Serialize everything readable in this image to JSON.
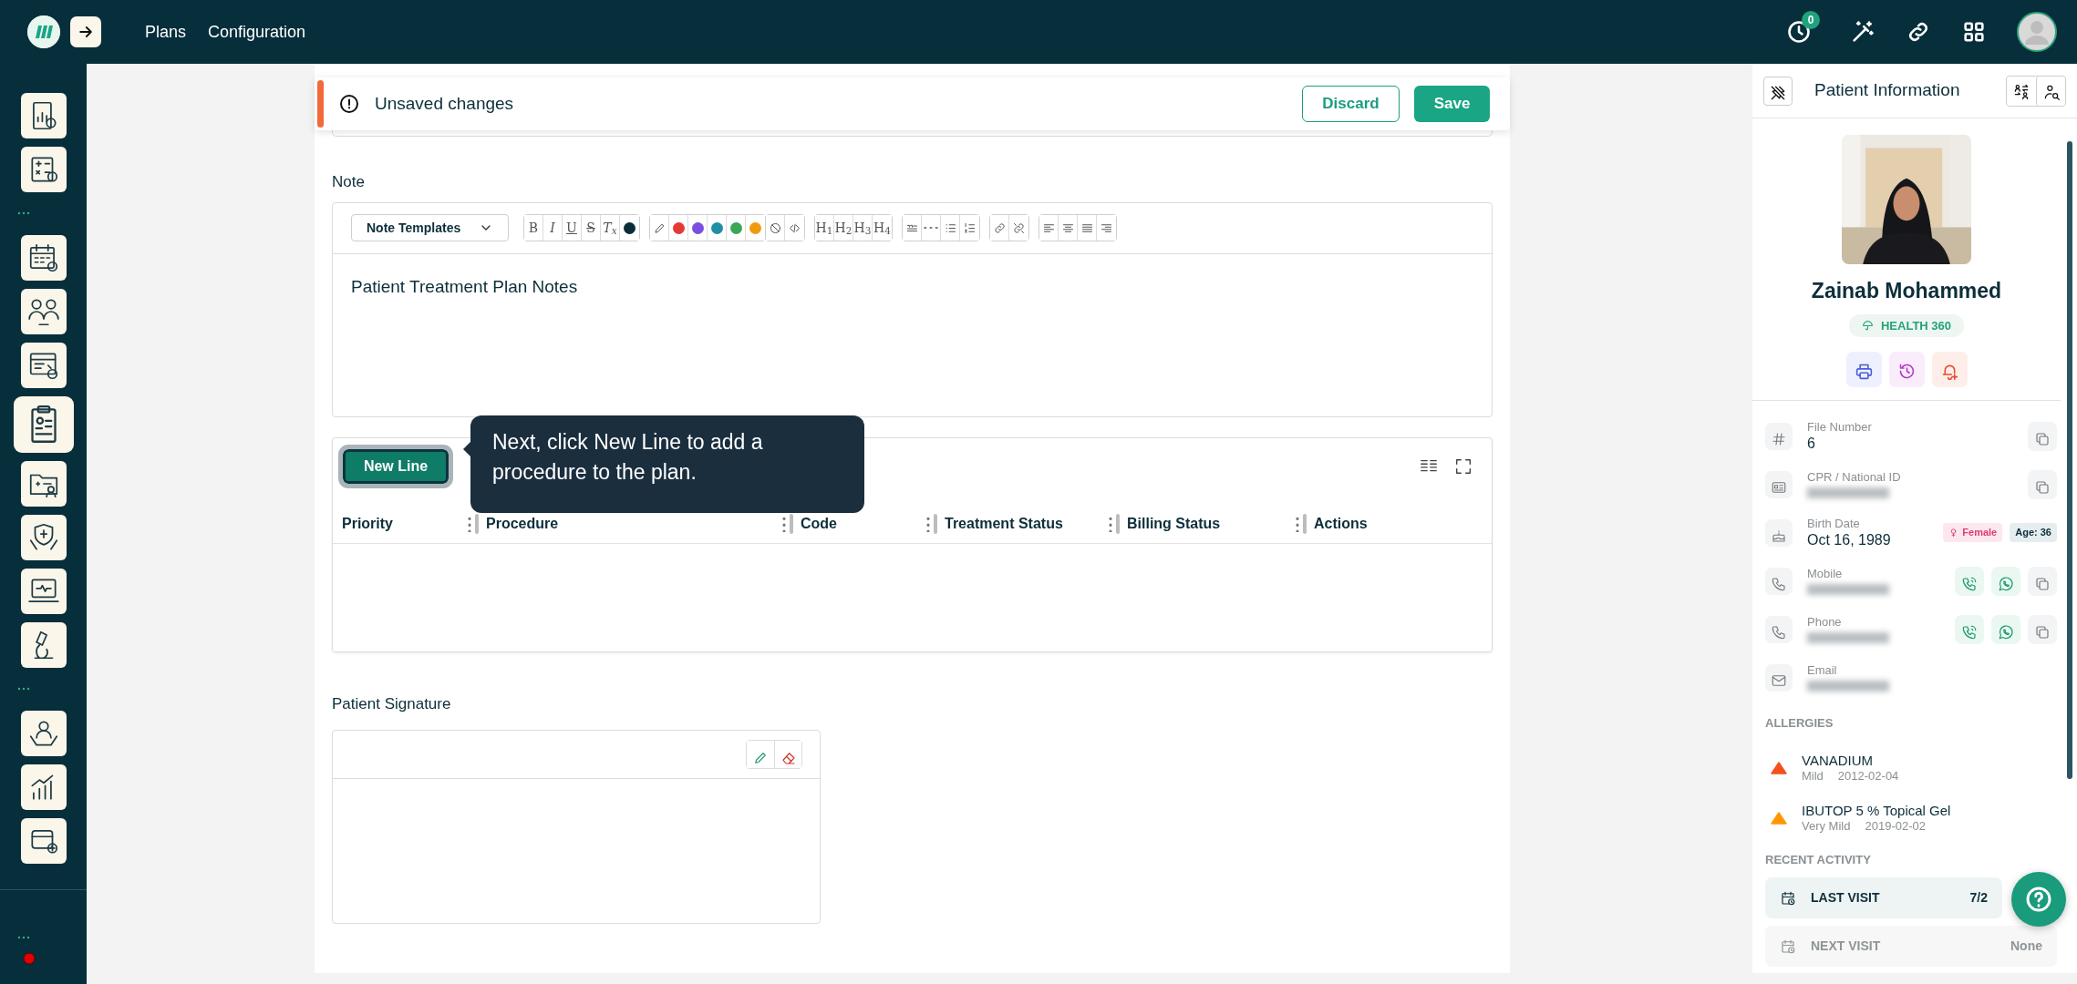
{
  "topbar": {
    "nav": [
      {
        "label": "Plans"
      },
      {
        "label": "Configuration"
      }
    ],
    "notification_count": "0"
  },
  "sidebar": {
    "items": [
      {
        "kind": "icon",
        "selected": false
      },
      {
        "kind": "icon",
        "selected": false
      },
      {
        "kind": "separator"
      },
      {
        "kind": "icon",
        "selected": false
      },
      {
        "kind": "icon",
        "selected": false
      },
      {
        "kind": "icon",
        "selected": false
      },
      {
        "kind": "icon",
        "selected": true
      },
      {
        "kind": "icon",
        "selected": false
      },
      {
        "kind": "icon",
        "selected": false
      },
      {
        "kind": "icon",
        "selected": false
      },
      {
        "kind": "icon",
        "selected": false
      },
      {
        "kind": "separator"
      },
      {
        "kind": "icon",
        "selected": false
      },
      {
        "kind": "icon",
        "selected": false
      },
      {
        "kind": "icon",
        "selected": false
      }
    ]
  },
  "banner": {
    "message": "Unsaved changes",
    "buttons": [
      {
        "label": "Discard",
        "kind": "outline"
      },
      {
        "label": "Save",
        "kind": "primary"
      }
    ]
  },
  "note": {
    "label": "Note",
    "template_button": "Note Templates",
    "content": "Patient Treatment Plan Notes",
    "toolbar": [
      [
        {
          "kind": "letter",
          "label": "B"
        },
        {
          "kind": "letter",
          "label": "I"
        },
        {
          "kind": "letter",
          "label": "U"
        },
        {
          "kind": "letter",
          "label": "S"
        },
        {
          "kind": "letter",
          "label": "T$_{x}$"
        },
        {
          "kind": "color",
          "color": "#0b2d3a"
        }
      ],
      [
        {
          "kind": "pen"
        },
        {
          "kind": "color",
          "color": "#e53935"
        },
        {
          "kind": "color",
          "color": "#7b4fe0"
        },
        {
          "kind": "color",
          "color": "#1e8fa6"
        },
        {
          "kind": "color",
          "color": "#3aa757"
        },
        {
          "kind": "color",
          "color": "#f09a0e"
        }
      ],
      [
        {
          "kind": "clear"
        },
        {
          "kind": "code"
        }
      ],
      [
        {
          "kind": "letter",
          "label": "H$_{1}$"
        },
        {
          "kind": "letter",
          "label": "H$_{2}$"
        },
        {
          "kind": "letter",
          "label": "H$_{3}$"
        },
        {
          "kind": "letter",
          "label": "H$_{4}$"
        }
      ],
      [
        {
          "kind": "quote"
        },
        {
          "kind": "hr"
        },
        {
          "kind": "bullets"
        },
        {
          "kind": "numbers"
        }
      ],
      [
        {
          "kind": "link"
        },
        {
          "kind": "unlink"
        }
      ],
      [
        {
          "kind": "align-left"
        },
        {
          "kind": "align-center"
        },
        {
          "kind": "align-justify"
        },
        {
          "kind": "align-right"
        }
      ]
    ]
  },
  "procedures": {
    "new_line_button": "New Line",
    "tooltip": "Next, click New Line to add a procedure to the plan.",
    "columns": [
      {
        "label": "Priority"
      },
      {
        "label": "Procedure"
      },
      {
        "label": "Code"
      },
      {
        "label": "Treatment Status"
      },
      {
        "label": "Billing Status"
      },
      {
        "label": "Actions"
      }
    ]
  },
  "signature": {
    "label": "Patient Signature"
  },
  "patient_panel": {
    "title": "Patient Information",
    "name": "Zainab Mohammed",
    "program": "HEALTH 360",
    "fields": [
      {
        "kind": "number",
        "label": "File Number",
        "value": "6"
      },
      {
        "kind": "id",
        "label": "CPR / National ID",
        "redacted": true
      },
      {
        "kind": "birth",
        "label": "Birth Date",
        "value": "Oct 16, 1989",
        "gender": "Female",
        "age": "Age: 36"
      },
      {
        "kind": "phone",
        "label": "Mobile",
        "redacted": true
      },
      {
        "kind": "phone",
        "label": "Phone",
        "redacted": true
      },
      {
        "kind": "email",
        "label": "Email",
        "redacted": true
      }
    ],
    "allergies_heading": "ALLERGIES",
    "allergies": [
      {
        "name": "VANADIUM",
        "severity": "Mild",
        "date": "2012-02-04",
        "color": "#f4511e"
      },
      {
        "name": "IBUTOP 5 % Topical Gel",
        "severity": "Very Mild",
        "date": "2019-02-02",
        "color": "#ff9800"
      }
    ],
    "activity_heading": "RECENT ACTIVITY",
    "activity": [
      {
        "label": "LAST VISIT",
        "value": "7/2",
        "selected": true
      },
      {
        "label": "NEXT VISIT",
        "value": "None",
        "selected": false
      }
    ]
  }
}
